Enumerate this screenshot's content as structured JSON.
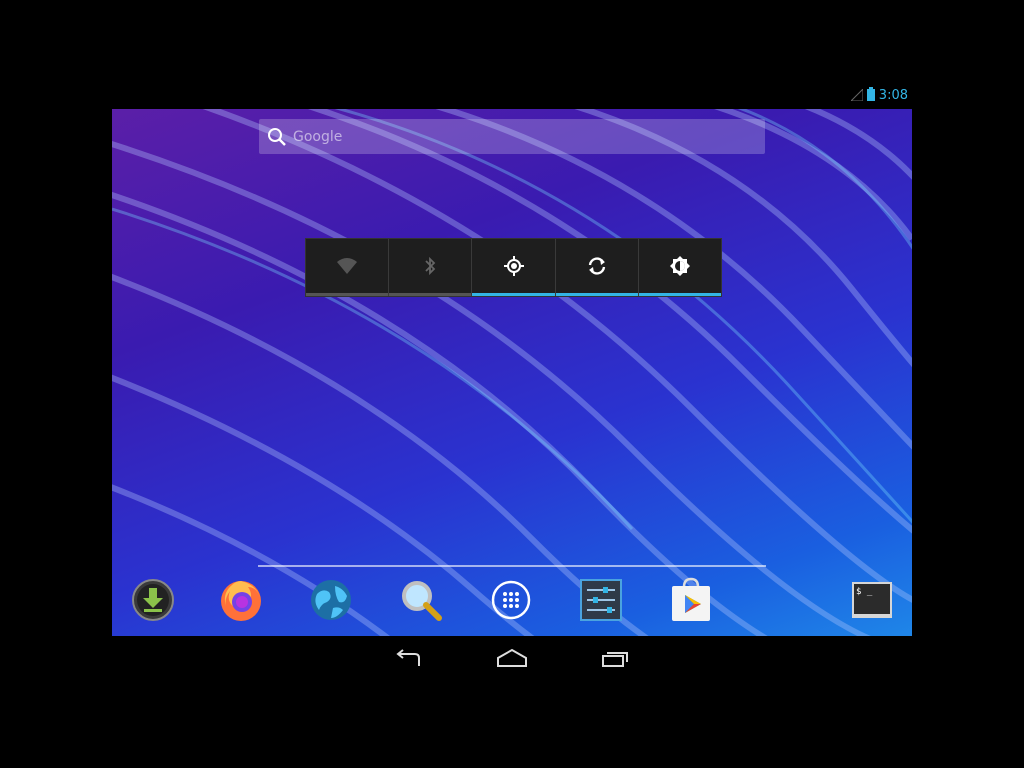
{
  "status_bar": {
    "time": "3:08",
    "icons": [
      "signal-icon",
      "battery-icon"
    ]
  },
  "search_widget": {
    "label": "Google",
    "icon": "search-icon"
  },
  "power_widget": {
    "toggles": [
      {
        "name": "wifi",
        "icon": "wifi-icon",
        "state": "off"
      },
      {
        "name": "bluetooth",
        "icon": "bluetooth-icon",
        "state": "off"
      },
      {
        "name": "gps",
        "icon": "gps-icon",
        "state": "on"
      },
      {
        "name": "sync",
        "icon": "sync-icon",
        "state": "on"
      },
      {
        "name": "brightness",
        "icon": "brightness-icon",
        "state": "on"
      }
    ]
  },
  "dock": {
    "apps": [
      {
        "name": "downloads",
        "icon": "download-icon"
      },
      {
        "name": "firefox",
        "icon": "firefox-icon"
      },
      {
        "name": "browser",
        "icon": "globe-icon"
      },
      {
        "name": "search",
        "icon": "magnifier-icon"
      },
      {
        "name": "all-apps",
        "icon": "app-drawer-icon"
      },
      {
        "name": "settings",
        "icon": "settings-icon"
      },
      {
        "name": "play-store",
        "icon": "play-store-icon"
      },
      {
        "name": "terminal",
        "icon": "terminal-icon"
      }
    ]
  },
  "nav_bar": {
    "buttons": [
      "back-icon",
      "home-icon",
      "recents-icon"
    ]
  },
  "colors": {
    "accent": "#33b5e5",
    "widget_bg": "#1e1e1e",
    "wallpaper_start": "#5b1fa8",
    "wallpaper_end": "#1f86e8"
  }
}
